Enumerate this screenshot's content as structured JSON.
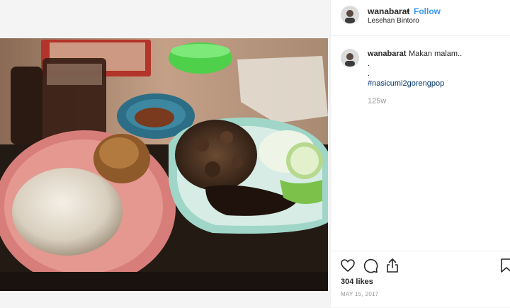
{
  "post": {
    "username": "wanabarat",
    "separator": "•",
    "follow_label": "Follow",
    "location": "Lesehan Bintoro",
    "caption_text": "Makan malam..",
    "caption_dot1": ".",
    "caption_dot2": ".",
    "hashtag": "#nasicumi2gorengpop",
    "time_ago": "125w",
    "likes": "304 likes",
    "date": "MAY 15, 2017"
  },
  "icons": {
    "like": "heart-icon",
    "comment": "comment-icon",
    "share": "share-icon",
    "save": "bookmark-icon"
  },
  "colors": {
    "follow": "#3897f0",
    "hashtag": "#003569",
    "muted": "#999999"
  }
}
